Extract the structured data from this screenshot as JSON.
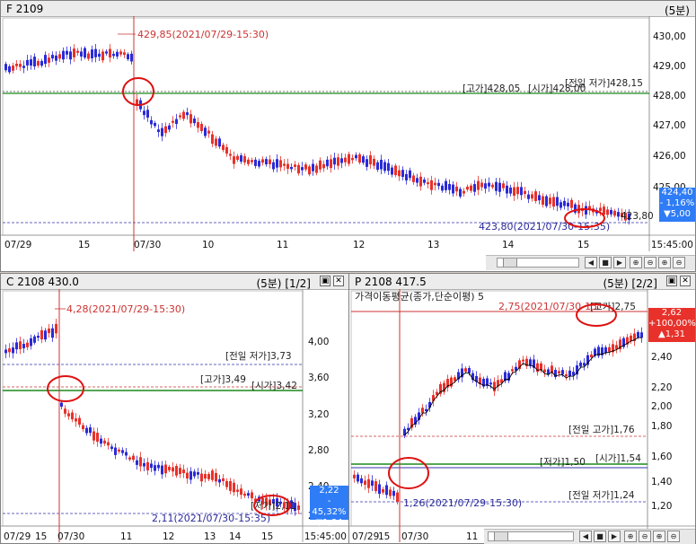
{
  "top": {
    "title": "F 2109",
    "interval": "(5분)",
    "y_ticks": [
      "430,00",
      "429,00",
      "428,00",
      "427,00",
      "426,00",
      "425,00"
    ],
    "x_ticks": [
      "07/29",
      "15",
      "07/30",
      "10",
      "11",
      "12",
      "13",
      "14",
      "15",
      "15:45:00"
    ],
    "annot_high_prev": "429,85(2021/07/29-15:30)",
    "annot_prev_low": "[전일 저가]428,15",
    "annot_high": "[고가]428,05",
    "annot_open": "[시가]428,00",
    "annot_low": "423,80(2021/07/30-15:35)",
    "annot_low_right": "423,80",
    "last_price": "424,40",
    "change_pct": "- 1,16%",
    "change_abs": "▼5,00"
  },
  "left": {
    "title": "C 2108 430.0",
    "interval": "(5분)",
    "page": "[1/2]",
    "y_ticks": [
      "4,00",
      "3,60",
      "3,20",
      "2,80",
      "2,40",
      "2,00"
    ],
    "x_ticks": [
      "07/29",
      "15",
      "07/30",
      "11",
      "12",
      "13",
      "14",
      "15",
      "15:45:00"
    ],
    "annot_high_prev": "4,28(2021/07/29-15:30)",
    "annot_prev_low": "[전일 저가]3,73",
    "annot_high": "[고가]3,49",
    "annot_open": "[시가]3,42",
    "annot_low": "2,11(2021/07/30-15:35)",
    "annot_low_right": "[저가]2,11",
    "last_price": "2,22",
    "change_pct": "- 45,32%",
    "change_abs": "▼1,84"
  },
  "right": {
    "title": "P 2108 417.5",
    "interval": "(5분)",
    "page": "[2/2]",
    "legend": "가격이동평균(종가,단순이평) 5",
    "y_ticks": [
      "2,60",
      "2,40",
      "2,20",
      "2,00",
      "1,80",
      "1,60",
      "1,40",
      "1,20"
    ],
    "x_ticks": [
      "07/29",
      "15",
      "07/30",
      "11",
      "12",
      "13",
      "14",
      "15",
      "15:45:00"
    ],
    "annot_high": "2,75(2021/07/30-15:",
    "annot_high_right": "[고가]2,75",
    "annot_prev_high": "[전일 고가]1,76",
    "annot_open": "[시가]1,54",
    "annot_low_day": "[저가]1,50",
    "annot_low_prev": "1,26(2021/07/29-15:30)",
    "annot_prev_low": "[전일 저가]1,24",
    "last_price": "2,62",
    "change_pct": "+100,00%",
    "change_abs": "▲1,31"
  },
  "colors": {
    "up": "#e8312a",
    "down": "#2a2ad8",
    "ma": "#000000",
    "hline_green": "#1a8a1a",
    "hline_red": "#cc3333",
    "hline_blue": "#3333aa",
    "circle": "#dd1111",
    "badge": "#2e7cf6"
  }
}
